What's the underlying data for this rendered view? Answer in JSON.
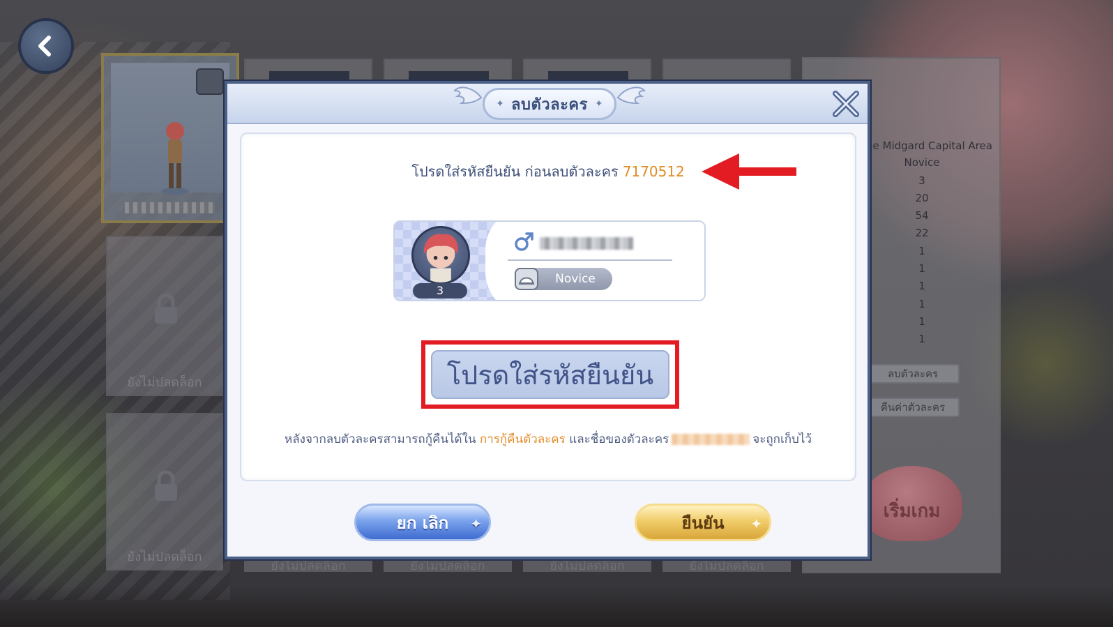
{
  "background": {
    "slots": {
      "lock_label_1": "ยังไม่ปลดล็อก",
      "lock_label_2": "ยังไม่ปลดล็อก",
      "bottom_labels": [
        "ยังไม่ปลดล็อก",
        "ยังไม่ปลดล็อก",
        "ยังไม่ปลดล็อก",
        "ยังไม่ปลดล็อก"
      ]
    },
    "info_panel": {
      "region": "ne Midgard Capital Area",
      "job": "Novice",
      "stats": [
        "3",
        "20",
        "54",
        "22",
        "1",
        "1",
        "1",
        "1",
        "1",
        "1"
      ],
      "delete_button": "ลบตัวละคร",
      "restore_button": "คืนค่าตัวละคร"
    },
    "start_button": "เริ่มเกม"
  },
  "modal": {
    "title": "ลบตัวละคร",
    "prompt": "โปรดใส่รหัสยืนยัน ก่อนลบตัวละคร",
    "confirm_code": "7170512",
    "character": {
      "level": "3",
      "job": "Novice",
      "gender_icon": "male-icon"
    },
    "input_placeholder": "โปรดใส่รหัสยืนยัน",
    "note_prefix": "หลังจากลบตัวละครสามารถกู้คืนได้ใน",
    "note_link": "การกู้คืนตัวละคร",
    "note_middle": "และชื่อของตัวละคร",
    "note_suffix": "จะถูกเก็บไว้",
    "cancel_label": "ยก เลิก",
    "confirm_label": "ยืนยัน"
  },
  "colors": {
    "highlight_red": "#e31b23",
    "code_orange": "#e08b25",
    "title_blue": "#3b4f7c"
  }
}
